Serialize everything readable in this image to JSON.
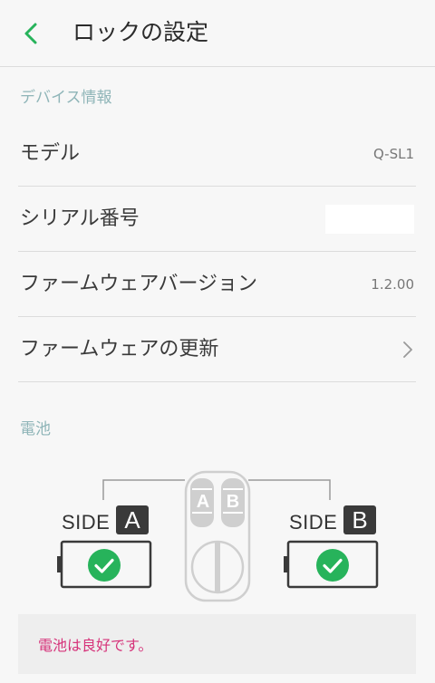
{
  "header": {
    "title": "ロックの設定",
    "back_icon": "chevron-left-icon"
  },
  "device_info": {
    "section_label": "デバイス情報",
    "rows": [
      {
        "label": "モデル",
        "value": "Q-SL1"
      },
      {
        "label": "シリアル番号",
        "value": ""
      },
      {
        "label": "ファームウェアバージョン",
        "value": "1.2.00"
      },
      {
        "label": "ファームウェアの更新",
        "icon": "chevron-right-icon"
      }
    ]
  },
  "battery": {
    "section_label": "電池",
    "side_a": {
      "label": "SIDE",
      "letter": "A",
      "status_icon": "check-circle-icon"
    },
    "side_b": {
      "label": "SIDE",
      "letter": "B",
      "status_icon": "check-circle-icon"
    },
    "lock_buttons": {
      "a": "A",
      "b": "B"
    },
    "message": "電池は良好です。"
  },
  "colors": {
    "accent_green": "#27b35b",
    "section_label": "#8fb5b8",
    "alert_text": "#d6337a"
  }
}
